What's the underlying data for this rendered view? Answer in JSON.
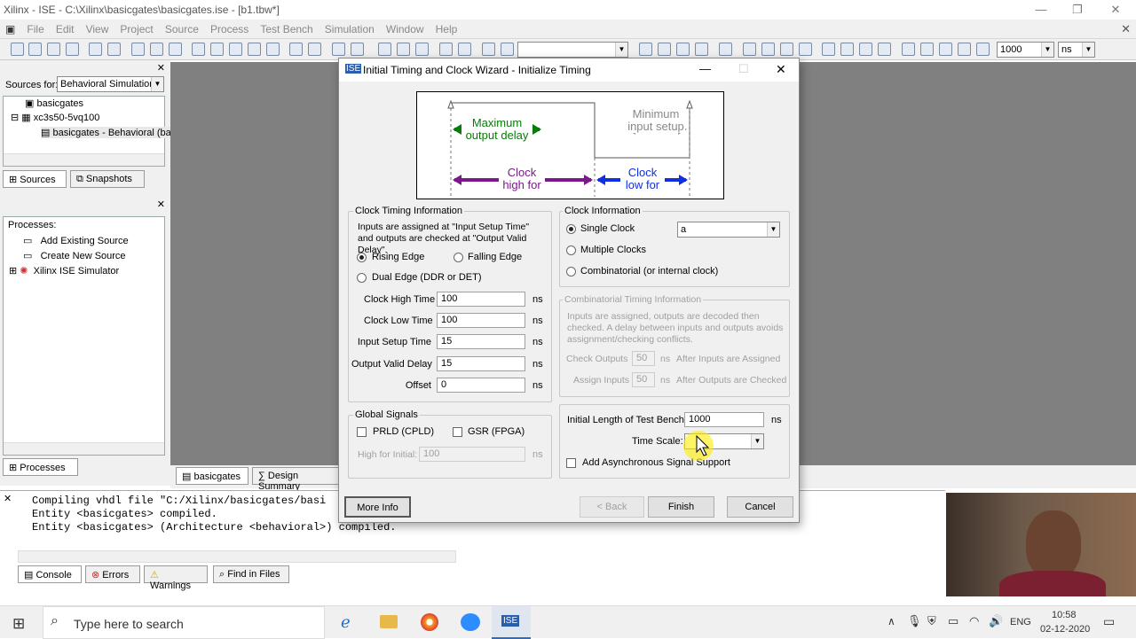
{
  "app": {
    "title": "Xilinx - ISE - C:\\Xilinx\\basicgates\\basicgates.ise - [b1.tbw*]"
  },
  "menu": [
    "File",
    "Edit",
    "View",
    "Project",
    "Source",
    "Process",
    "Test Bench",
    "Simulation",
    "Window",
    "Help"
  ],
  "toolbar": {
    "zoom_value": "1000",
    "unit_value": "ns"
  },
  "sources": {
    "label": "Sources for:",
    "selected": "Behavioral Simulation",
    "tree": [
      "basicgates",
      "xc3s50-5vq100",
      "basicgates - Behavioral (bas"
    ],
    "tabs": [
      "Sources",
      "Snapshots"
    ]
  },
  "processes": {
    "label": "Processes:",
    "items": [
      "Add Existing Source",
      "Create New Source",
      "Xilinx ISE Simulator"
    ],
    "tab": "Processes"
  },
  "doc_tabs": [
    "basicgates",
    "Design Summary"
  ],
  "dialog": {
    "title": "Initial Timing and Clock Wizard - Initialize Timing",
    "diagram": {
      "max_out": "Maximum output delay",
      "min_in": "Minimum input setup",
      "clk_high": "Clock high for",
      "clk_low": "Clock low for"
    },
    "clock_timing": {
      "legend": "Clock Timing Information",
      "desc": "Inputs are assigned at \"Input Setup Time\" and outputs are checked at \"Output Valid Delay\".",
      "rising": "Rising Edge",
      "falling": "Falling Edge",
      "dual": "Dual Edge (DDR or DET)",
      "fields": [
        {
          "label": "Clock High Time",
          "value": "100",
          "unit": "ns"
        },
        {
          "label": "Clock Low Time",
          "value": "100",
          "unit": "ns"
        },
        {
          "label": "Input Setup Time",
          "value": "15",
          "unit": "ns"
        },
        {
          "label": "Output Valid Delay",
          "value": "15",
          "unit": "ns"
        },
        {
          "label": "Offset",
          "value": "0",
          "unit": "ns"
        }
      ]
    },
    "clock_info": {
      "legend": "Clock Information",
      "single": "Single Clock",
      "single_value": "a",
      "multiple": "Multiple Clocks",
      "comb": "Combinatorial (or internal clock)"
    },
    "comb_timing": {
      "legend": "Combinatorial Timing Information",
      "desc": "Inputs are assigned, outputs are decoded then checked. A delay between inputs and outputs avoids assignment/checking conflicts.",
      "check_label": "Check Outputs",
      "check_value": "50",
      "check_unit": "ns",
      "check_after": "After Inputs are Assigned",
      "assign_label": "Assign Inputs",
      "assign_value": "50",
      "assign_unit": "ns",
      "assign_after": "After Outputs are Checked"
    },
    "global": {
      "legend": "Global Signals",
      "prld": "PRLD (CPLD)",
      "gsr": "GSR (FPGA)",
      "high_label": "High for Initial:",
      "high_value": "100",
      "high_unit": "ns"
    },
    "bench": {
      "length_label": "Initial Length of Test Bench:",
      "length_value": "1000",
      "length_unit": "ns",
      "timescale_label": "Time Scale:",
      "async": "Add Asynchronous Signal Support"
    },
    "buttons": {
      "more": "More Info",
      "back": "< Back",
      "finish": "Finish",
      "cancel": "Cancel"
    }
  },
  "console": {
    "lines": [
      "Compiling vhdl file \"C:/Xilinx/basicgates/basi",
      "Entity <basicgates> compiled.",
      "Entity <basicgates> (Architecture <behavioral>) compiled."
    ],
    "tabs": [
      "Console",
      "Errors",
      "Warnings",
      "Find in Files"
    ]
  },
  "taskbar": {
    "search": "Type here to search",
    "lang": "ENG",
    "time": "10:58",
    "date": "02-12-2020"
  }
}
